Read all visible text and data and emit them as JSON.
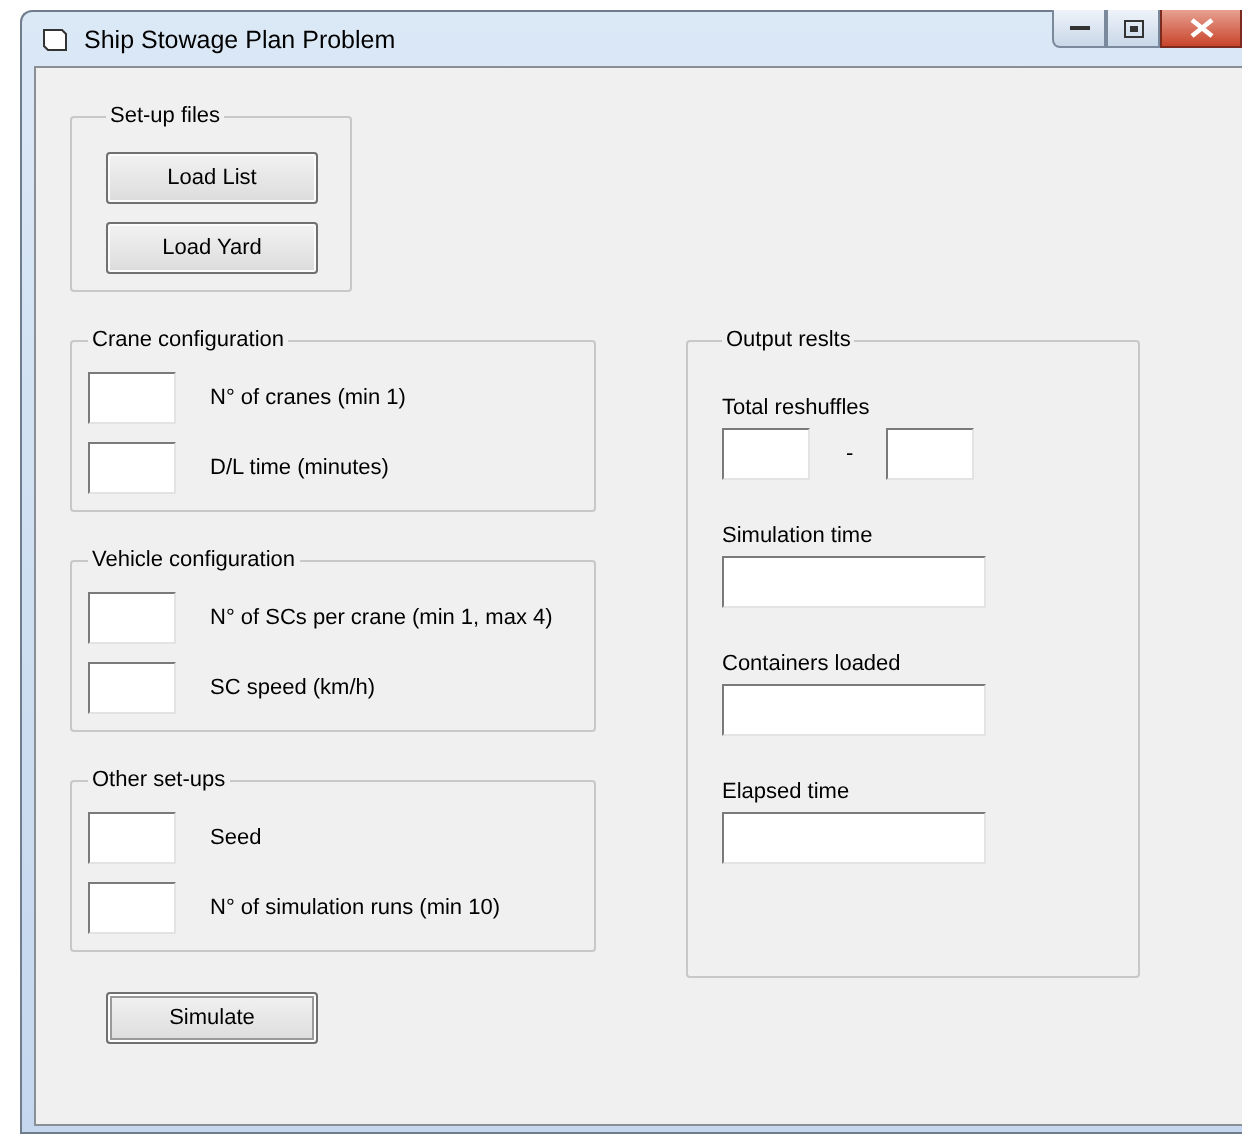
{
  "window": {
    "title": "Ship Stowage Plan Problem"
  },
  "setup_files": {
    "title": "Set-up files",
    "buttons": [
      "Load List",
      "Load Yard"
    ]
  },
  "groups": [
    {
      "title": "Crane configuration",
      "fields": [
        {
          "label": "N° of cranes (min 1)"
        },
        {
          "label": "D/L time (minutes)"
        }
      ]
    },
    {
      "title": "Vehicle configuration",
      "fields": [
        {
          "label": "N° of SCs per crane (min 1, max 4)"
        },
        {
          "label": "SC speed (km/h)"
        }
      ]
    },
    {
      "title": "Other set-ups",
      "fields": [
        {
          "label": "Seed"
        },
        {
          "label": "N° of simulation runs (min 10)"
        }
      ]
    }
  ],
  "simulate_button": "Simulate",
  "output": {
    "title": "Output reslts",
    "reshuffles": {
      "label": "Total reshuffles",
      "separator": "-"
    },
    "fields": [
      {
        "label": "Simulation time"
      },
      {
        "label": "Containers loaded"
      },
      {
        "label": "Elapsed time"
      }
    ]
  }
}
